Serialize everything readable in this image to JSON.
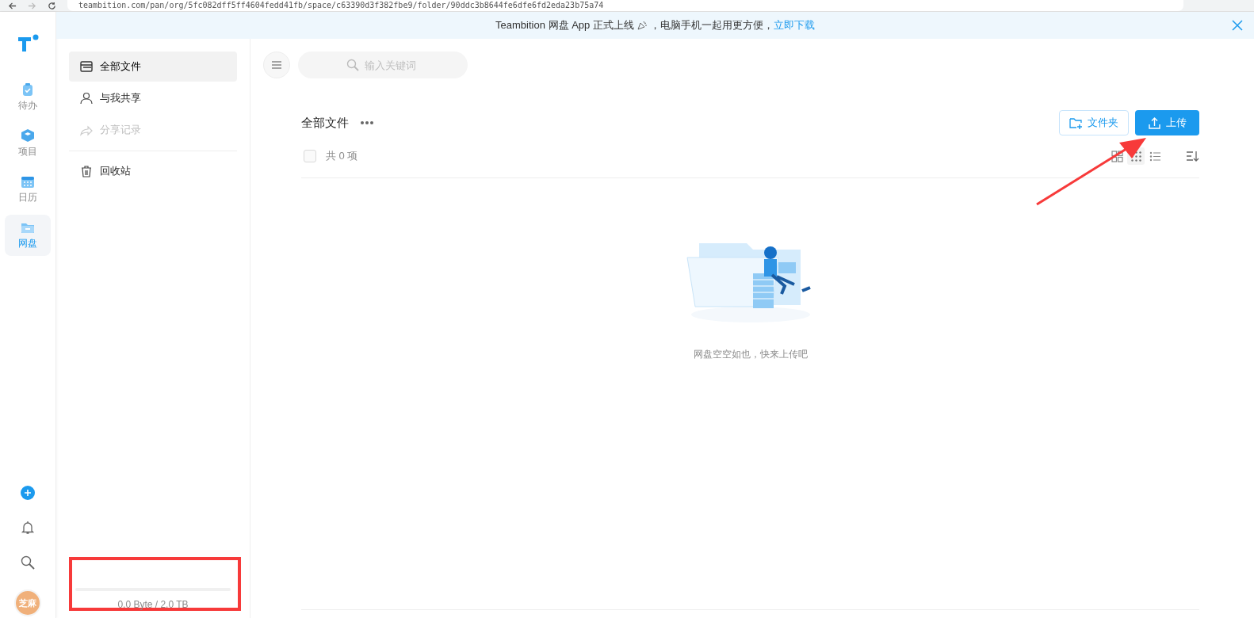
{
  "browser": {
    "address": "teambition.com/pan/org/5fc082dff5ff4604fedd41fb/space/c63390d3f382fbe9/folder/90ddc3b8644fe6dfe6fd2eda23b75a74"
  },
  "banner": {
    "text": "Teambition 网盘 App 正式上线",
    "text_2": "，电脑手机一起用更方便，",
    "link": "立即下载"
  },
  "rail": {
    "items": [
      {
        "kind": "todo",
        "label": "待办",
        "selected": false
      },
      {
        "kind": "project",
        "label": "项目",
        "selected": false
      },
      {
        "kind": "calendar",
        "label": "日历",
        "selected": false
      },
      {
        "kind": "drive",
        "label": "网盘",
        "selected": true
      }
    ],
    "avatar": "芝麻"
  },
  "sidebar": {
    "groups": [
      [
        {
          "kind": "files",
          "label": "全部文件",
          "selected": true,
          "disabled": false
        },
        {
          "kind": "shared",
          "label": "与我共享",
          "selected": false,
          "disabled": false
        },
        {
          "kind": "history",
          "label": "分享记录",
          "selected": false,
          "disabled": true
        }
      ],
      [
        {
          "kind": "trash",
          "label": "回收站",
          "selected": false,
          "disabled": false
        }
      ]
    ]
  },
  "storage": {
    "level": 0,
    "text": "0.0 Byte / 2.0 TB"
  },
  "main": {
    "search": {
      "placeholder": "输入关键词"
    },
    "title": "全部文件",
    "select_all": {
      "checked": false
    },
    "count": "共 0 项",
    "buttons": [
      {
        "kind": "folder",
        "label": "文件夹"
      },
      {
        "kind": "upload",
        "label": "上传"
      }
    ],
    "views": [
      {
        "kind": "grid-large",
        "selected": false
      },
      {
        "kind": "grid-small",
        "selected": true
      },
      {
        "kind": "list",
        "selected": false
      }
    ],
    "empty_text": "网盘空空如也，快来上传吧"
  },
  "annotations": [
    {
      "kind": "box"
    },
    {
      "kind": "arrow"
    }
  ]
}
